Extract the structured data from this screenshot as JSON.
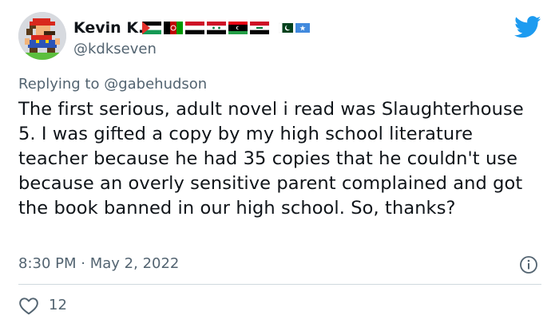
{
  "user": {
    "display_name": "Kevin K.",
    "handle": "@kdkseven"
  },
  "reply": {
    "prefix": "Replying to",
    "mention": "@gabehudson"
  },
  "tweet": {
    "text": "The first serious, adult novel i read was Slaughterhouse 5. I was gifted a copy by my high school literature teacher because he had 35 copies that he couldn't use because an overly sensitive parent complained and got the book banned in our high school. So, thanks?",
    "time": "8:30 PM",
    "separator": "·",
    "date": "May 2, 2022"
  },
  "engagement": {
    "likes": "12"
  },
  "colors": {
    "brand": "#1d9bf0",
    "secondary_text": "#536471",
    "divider": "#cfd9de"
  },
  "icons": [
    "twitter-bird-icon",
    "info-icon",
    "heart-icon"
  ]
}
